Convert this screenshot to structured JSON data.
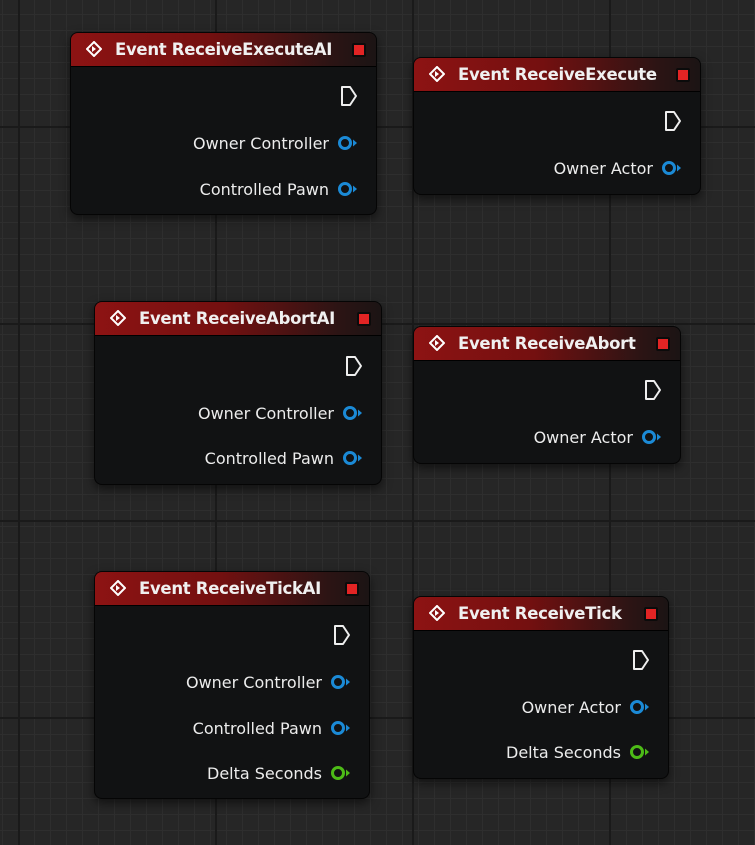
{
  "colors": {
    "header_red": "#8d1313",
    "object_pin": "#1b8ad6",
    "float_pin": "#4dbb17",
    "close_button": "#e22424"
  },
  "nodes": [
    {
      "title": "Event ReceiveExecuteAI",
      "pins": [
        {
          "label": "Owner Controller",
          "type": "object"
        },
        {
          "label": "Controlled Pawn",
          "type": "object"
        }
      ]
    },
    {
      "title": "Event ReceiveExecute",
      "pins": [
        {
          "label": "Owner Actor",
          "type": "object"
        }
      ]
    },
    {
      "title": "Event ReceiveAbortAI",
      "pins": [
        {
          "label": "Owner Controller",
          "type": "object"
        },
        {
          "label": "Controlled Pawn",
          "type": "object"
        }
      ]
    },
    {
      "title": "Event ReceiveAbort",
      "pins": [
        {
          "label": "Owner Actor",
          "type": "object"
        }
      ]
    },
    {
      "title": "Event ReceiveTickAI",
      "pins": [
        {
          "label": "Owner Controller",
          "type": "object"
        },
        {
          "label": "Controlled Pawn",
          "type": "object"
        },
        {
          "label": "Delta Seconds",
          "type": "float"
        }
      ]
    },
    {
      "title": "Event ReceiveTick",
      "pins": [
        {
          "label": "Owner Actor",
          "type": "object"
        },
        {
          "label": "Delta Seconds",
          "type": "float"
        }
      ]
    }
  ]
}
